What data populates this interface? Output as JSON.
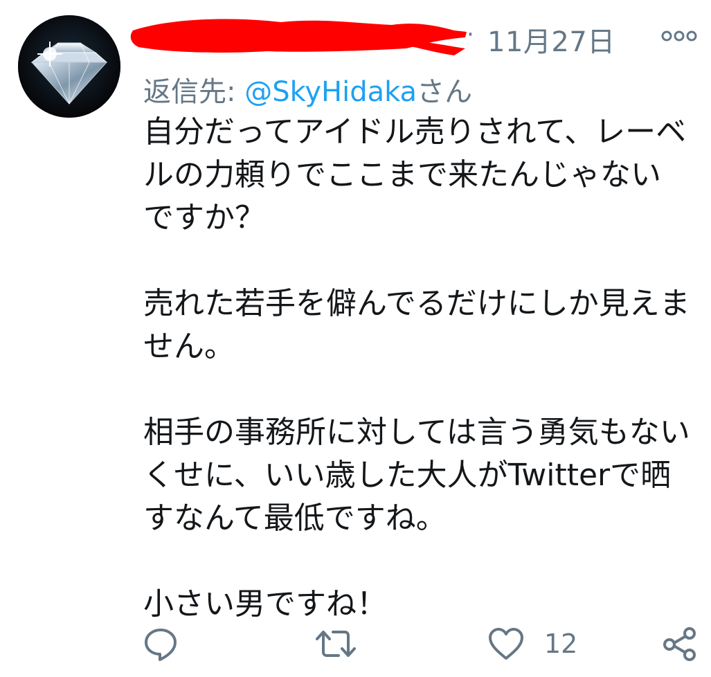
{
  "tweet": {
    "date": "11月27日",
    "separator": "·",
    "reply_to_prefix": "返信先: ",
    "reply_to_mention": "@SkyHidaka",
    "reply_to_suffix": "さん",
    "paragraphs": [
      "自分だってアイドル売りされて、レーベルの力頼りでここまで来たんじゃないですか？",
      "売れた若手を僻んでるだけにしか見えません。",
      "相手の事務所に対しては言う勇気もないくせに、いい歳した大人がTwitterで晒すなんて最低ですね。",
      "小さい男ですね！"
    ],
    "like_count": "12"
  },
  "icons": {
    "more": "more-horizontal-icon",
    "reply": "reply-icon",
    "retweet": "retweet-icon",
    "like": "heart-icon",
    "share": "share-icon"
  },
  "colors": {
    "redaction": "#ff0000",
    "secondary_text": "#657786",
    "mention": "#1da1f2",
    "primary_text": "#14171a"
  }
}
